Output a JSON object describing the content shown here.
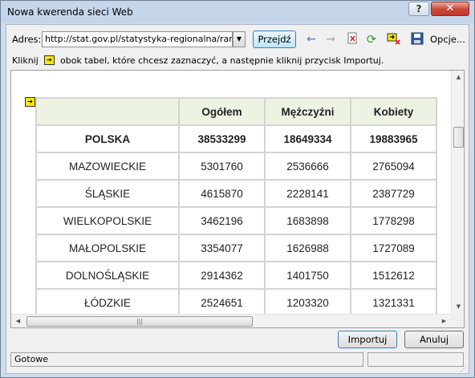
{
  "window": {
    "title": "Nowa kwerenda sieci Web",
    "help_label": "?",
    "close_label": "✕"
  },
  "toolbar": {
    "address_label": "Adres:",
    "address_value": "http://stat.gov.pl/statystyka-regionalna/rankingi-statystyczne/ranking-wojewodztw/",
    "go_label": "Przejdź",
    "options_label": "Opcje...",
    "icons": [
      "back-arrow-icon",
      "forward-arrow-icon",
      "stop-icon",
      "refresh-icon",
      "no-marks-icon",
      "save-query-icon"
    ]
  },
  "hint": {
    "prefix": "Kliknij",
    "text": "obok tabel, które chcesz zaznaczyć, a następnie kliknij przycisk Importuj."
  },
  "table": {
    "headers": [
      "",
      "Ogółem",
      "Mężczyźni",
      "Kobiety"
    ],
    "rows": [
      [
        "POLSKA",
        "38533299",
        "18649334",
        "19883965"
      ],
      [
        "MAZOWIECKIE",
        "5301760",
        "2536666",
        "2765094"
      ],
      [
        "ŚLĄSKIE",
        "4615870",
        "2228141",
        "2387729"
      ],
      [
        "WIELKOPOLSKIE",
        "3462196",
        "1683898",
        "1778298"
      ],
      [
        "MAŁOPOLSKIE",
        "3354077",
        "1626988",
        "1727089"
      ],
      [
        "DOLNOŚLĄSKIE",
        "2914362",
        "1401750",
        "1512612"
      ],
      [
        "ŁÓDZKIE",
        "2524651",
        "1203320",
        "1321331"
      ]
    ]
  },
  "buttons": {
    "import_label": "Importuj",
    "cancel_label": "Anuluj"
  },
  "status": {
    "text": "Gotowe"
  },
  "colors": {
    "header_bg": "#edf3e2",
    "marker_yellow": "#ffe600",
    "close_red": "#c2392b"
  }
}
